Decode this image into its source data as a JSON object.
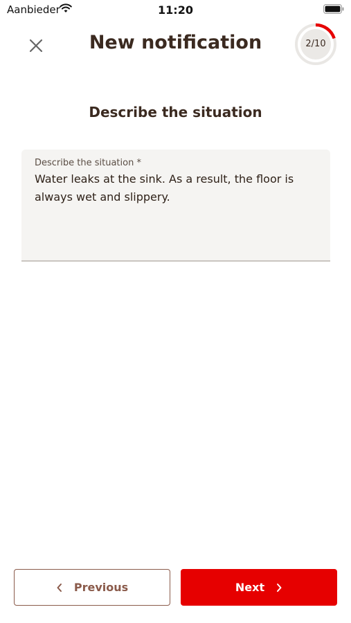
{
  "status_bar": {
    "carrier": "Aanbieder",
    "time": "11:20"
  },
  "header": {
    "title": "New notification",
    "close_icon": "close-icon",
    "progress": {
      "text": "2/10",
      "current": 2,
      "total": 10,
      "color": "#e60000"
    }
  },
  "section": {
    "title": "Describe the situation"
  },
  "field": {
    "label": "Describe the situation *",
    "value": "Water leaks at the sink. As a result, the floor is always wet and slippery."
  },
  "footer": {
    "previous_label": "Previous",
    "next_label": "Next",
    "accent": "#e60000",
    "secondary": "#8a5a4a"
  }
}
